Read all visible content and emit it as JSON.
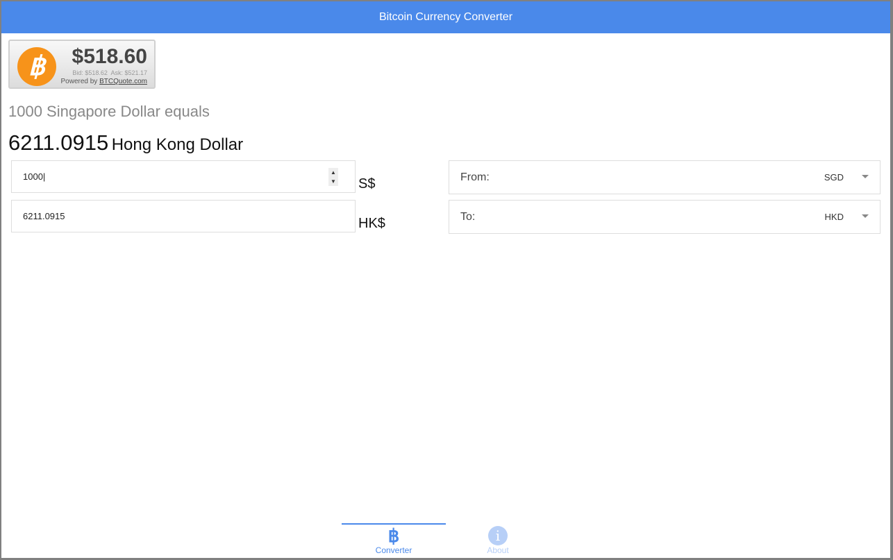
{
  "header": {
    "title": "Bitcoin Currency Converter"
  },
  "widget": {
    "price": "$518.60",
    "bid": "Bid: $518.62",
    "ask": "Ask: $521.17",
    "powered_by": "Powered by",
    "link": "BTCQuote.com",
    "logo": "฿"
  },
  "summary": {
    "equals": "1000 Singapore Dollar equals",
    "amount": "6211.0915",
    "currency": "Hong Kong Dollar"
  },
  "from": {
    "value": "1000",
    "symbol": "S$",
    "label": "From:",
    "code": "SGD"
  },
  "to": {
    "value": "6211.0915",
    "symbol": "HK$",
    "label": "To:",
    "code": "HKD"
  },
  "tabs": [
    {
      "label": "Converter",
      "icon": "฿"
    },
    {
      "label": "About",
      "icon": "i"
    }
  ],
  "colors": {
    "accent": "#4a89ea",
    "bitcoin": "#f7931a"
  }
}
